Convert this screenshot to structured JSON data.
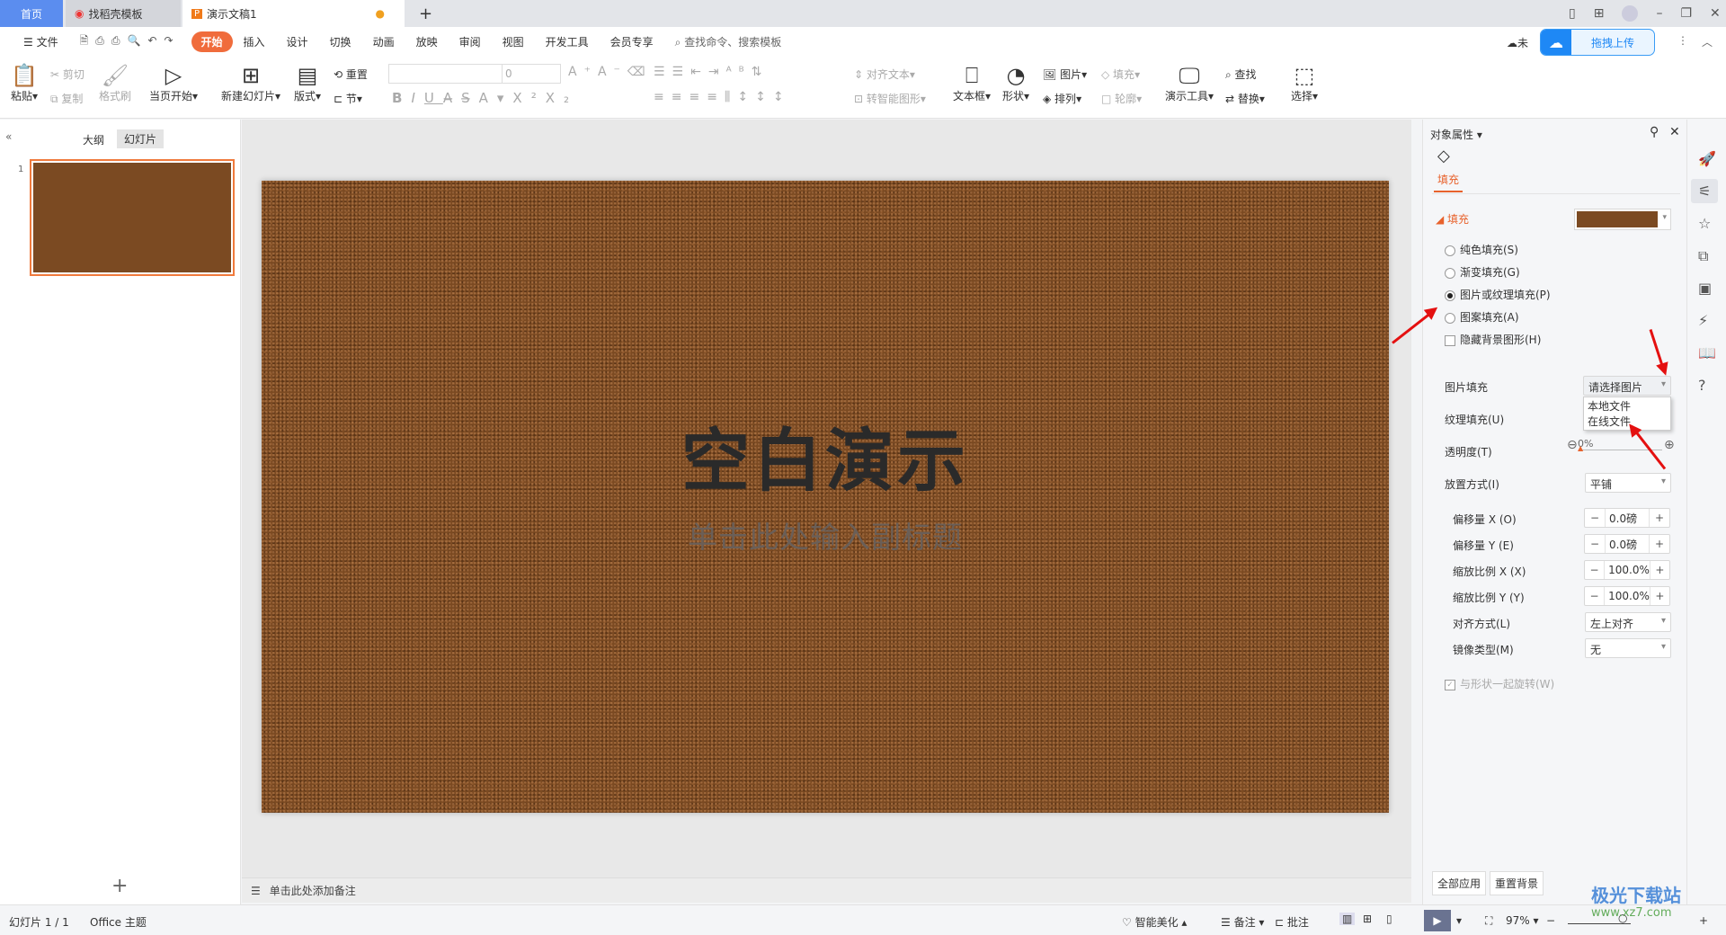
{
  "tabs": [
    {
      "label": "首页"
    },
    {
      "label": "找稻壳模板"
    },
    {
      "label": "演示文稿1"
    }
  ],
  "new_tab": "+",
  "menu": {
    "file": "文件",
    "items": [
      "开始",
      "插入",
      "设计",
      "切换",
      "动画",
      "放映",
      "审阅",
      "视图",
      "开发工具",
      "会员专享"
    ],
    "search": "查找命令、搜索模板",
    "sync": "未",
    "upload": "拖拽上传"
  },
  "ribbon": {
    "paste": "粘贴",
    "cut": "剪切",
    "copy": "复制",
    "format_painter": "格式刷",
    "play_from_current": "当页开始",
    "new_slide": "新建幻灯片",
    "layout": "版式",
    "reset": "重置",
    "section": "节",
    "font_size": "0",
    "align_text": "对齐文本",
    "smart_art": "转智能图形",
    "textbox": "文本框",
    "shape": "形状",
    "picture": "图片",
    "arrange": "排列",
    "fill": "填充",
    "outline": "轮廓",
    "present_tools": "演示工具",
    "find": "查找",
    "replace": "替换",
    "select": "选择"
  },
  "left": {
    "outline_tab": "大纲",
    "slides_tab": "幻灯片",
    "slide_number": "1",
    "add": "+"
  },
  "slide": {
    "title": "空白演示",
    "subtitle": "单击此处输入副标题"
  },
  "notes": {
    "placeholder": "单击此处添加备注"
  },
  "panel": {
    "header": "对象属性",
    "tab": "填充",
    "section": "填充",
    "options": [
      {
        "label": "纯色填充(S)",
        "checked": false
      },
      {
        "label": "渐变填充(G)",
        "checked": false
      },
      {
        "label": "图片或纹理填充(P)",
        "checked": true
      },
      {
        "label": "图案填充(A)",
        "checked": false
      }
    ],
    "hide_bg": "隐藏背景图形(H)",
    "picture_fill_label": "图片填充",
    "picture_fill_value": "请选择图片",
    "dropdown_options": [
      "本地文件",
      "在线文件"
    ],
    "texture_label": "纹理填充(U)",
    "transparency_label": "透明度(T)",
    "transparency_value": "0%",
    "placement_label": "放置方式(I)",
    "placement_value": "平铺",
    "spinners": [
      {
        "label": "偏移量 X (O)",
        "value": "0.0磅"
      },
      {
        "label": "偏移量 Y (E)",
        "value": "0.0磅"
      },
      {
        "label": "缩放比例 X (X)",
        "value": "100.0%"
      },
      {
        "label": "缩放比例 Y (Y)",
        "value": "100.0%"
      }
    ],
    "align_label": "对齐方式(L)",
    "align_value": "左上对齐",
    "mirror_label": "镜像类型(M)",
    "mirror_value": "无",
    "rotate": "与形状一起旋转(W)",
    "apply_all": "全部应用",
    "reset_bg": "重置背景"
  },
  "status": {
    "slide": "幻灯片 1 / 1",
    "theme": "Office 主题",
    "beautify": "智能美化",
    "notes": "备注",
    "comment": "批注",
    "zoom": "97%"
  },
  "watermark": {
    "name": "极光下载站",
    "url": "www.xz7.com"
  },
  "colors": {
    "accent": "#f06c3c",
    "home_tab": "#5b8def",
    "leather": "#7b4a22"
  }
}
